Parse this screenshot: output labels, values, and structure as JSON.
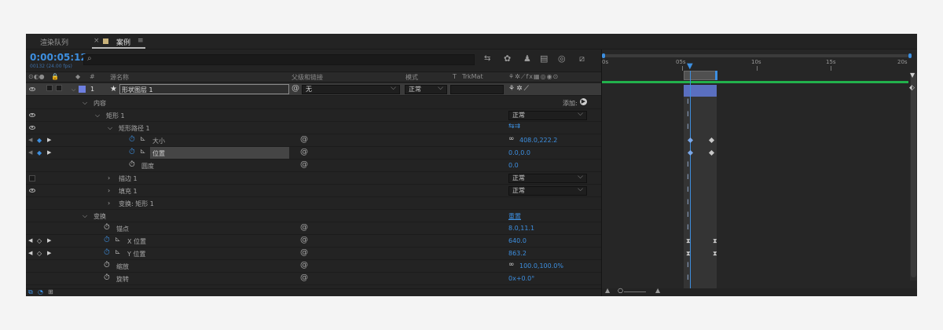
{
  "tabs": {
    "render_queue": "渲染队列",
    "active_close": "×",
    "active_label": "案例",
    "active_menu": "≡"
  },
  "toolbar": {
    "timecode": "0:00:05:12",
    "frame_info": "00132 (24.00 fps)",
    "search_placeholder": ""
  },
  "columns": {
    "index": "#",
    "source_name": "源名称",
    "parent": "父级和链接",
    "mode": "模式",
    "trkmat_t": "T",
    "trkmat": "TrkMat"
  },
  "layer": {
    "index": "1",
    "name": "形状图层 1",
    "parent_value": "无",
    "mode_value": "正常"
  },
  "rows": {
    "contents": "内容",
    "add_label": "添加:",
    "rect1": "矩形 1",
    "rect1_mode": "正常",
    "rect_path": "矩形路径 1",
    "size": "大小",
    "size_value": "408.0,222.2",
    "position": "位置",
    "position_value": "0.0,0.0",
    "roundness": "圆度",
    "roundness_value": "0.0",
    "stroke": "描边 1",
    "stroke_mode": "正常",
    "fill": "填充 1",
    "fill_mode": "正常",
    "transform_rect": "变换: 矩形 1",
    "transform": "变换",
    "reset": "重置",
    "anchor": "锚点",
    "anchor_value": "8.0,11.1",
    "x_pos": "X 位置",
    "x_pos_value": "640.0",
    "y_pos": "Y 位置",
    "y_pos_value": "863.2",
    "scale": "缩放",
    "scale_value": "100.0,100.0%",
    "rotation": "旋转",
    "rotation_value": "0x+0.0°"
  },
  "timeline": {
    "ticks": [
      "0s",
      "05s",
      "10s",
      "15s",
      "20s"
    ]
  },
  "colors": {
    "accent": "#3d8fe0",
    "layer_label": "#6e7fe0",
    "green_bar": "#22b14c",
    "background": "#232323"
  }
}
